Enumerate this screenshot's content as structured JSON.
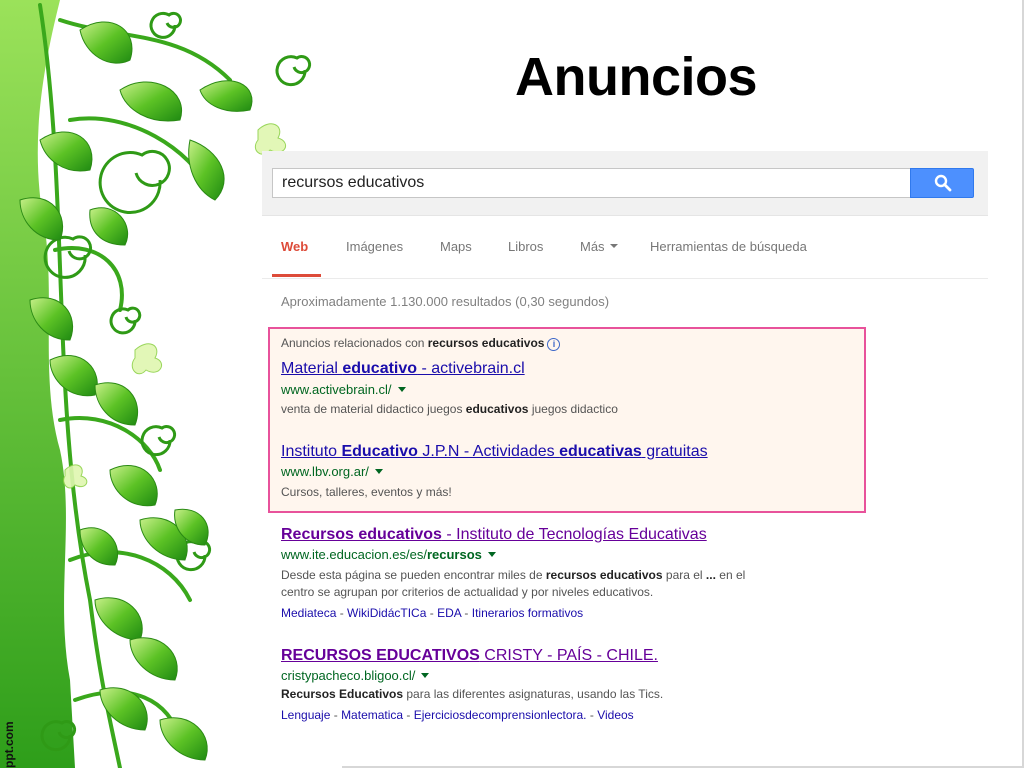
{
  "slide": {
    "title": "Anuncios",
    "watermark": "ppt.com"
  },
  "search": {
    "query": "recursos educativos",
    "button_icon": "search-icon"
  },
  "tabs": [
    {
      "label": "Web",
      "active": true
    },
    {
      "label": "Imágenes"
    },
    {
      "label": "Maps"
    },
    {
      "label": "Libros"
    },
    {
      "label": "Más"
    },
    {
      "label": "Herramientas de búsqueda"
    }
  ],
  "stats": "Aproximadamente 1.130.000 resultados (0,30 segundos)",
  "ads": {
    "header_prefix": "Anuncios relacionados con ",
    "header_bold": "recursos educativos",
    "items": [
      {
        "title_parts": [
          "Material ",
          "educativo",
          " - activebrain.cl"
        ],
        "url": "www.activebrain.cl/",
        "snippet_parts": [
          "venta de material didactico juegos ",
          "educativos",
          " juegos didactico"
        ]
      },
      {
        "title_parts": [
          "Instituto ",
          "Educativo",
          " J.P.N - Actividades ",
          "educativas",
          " gratuitas"
        ],
        "url": "www.lbv.org.ar/",
        "snippet": "Cursos, talleres, eventos y más!"
      }
    ]
  },
  "results": [
    {
      "title_parts": [
        "Recursos educativos",
        " - Instituto de Tecnologías Educativas"
      ],
      "url_parts": [
        "www.ite.educacion.es/es/",
        "recursos"
      ],
      "snippet_line1_parts": [
        "Desde esta página se pueden encontrar miles de ",
        "recursos educativos",
        " para el ",
        "...",
        " en el"
      ],
      "snippet_line2": "centro se agrupan por criterios de actualidad y por niveles educativos.",
      "sitelinks": [
        "Mediateca",
        "WikiDidácTICa",
        "EDA",
        "Itinerarios formativos"
      ]
    },
    {
      "title_parts": [
        "RECURSOS EDUCATIVOS",
        " CRISTY - PAÍS - CHILE."
      ],
      "url": "cristypacheco.bligoo.cl/",
      "snippet_parts": [
        "Recursos Educativos",
        " para las diferentes asignaturas, usando las Tics."
      ],
      "sitelinks": [
        "Lenguaje",
        "Matematica",
        "Ejerciciosdecomprensionlectora.",
        "Videos"
      ]
    }
  ],
  "colors": {
    "link": "#1a0dab",
    "visited": "#660099",
    "url": "#006621",
    "active_tab": "#dd4b39",
    "ad_border": "#e8529b",
    "ad_bg": "#fff6ee",
    "search_button": "#4d90fe"
  }
}
